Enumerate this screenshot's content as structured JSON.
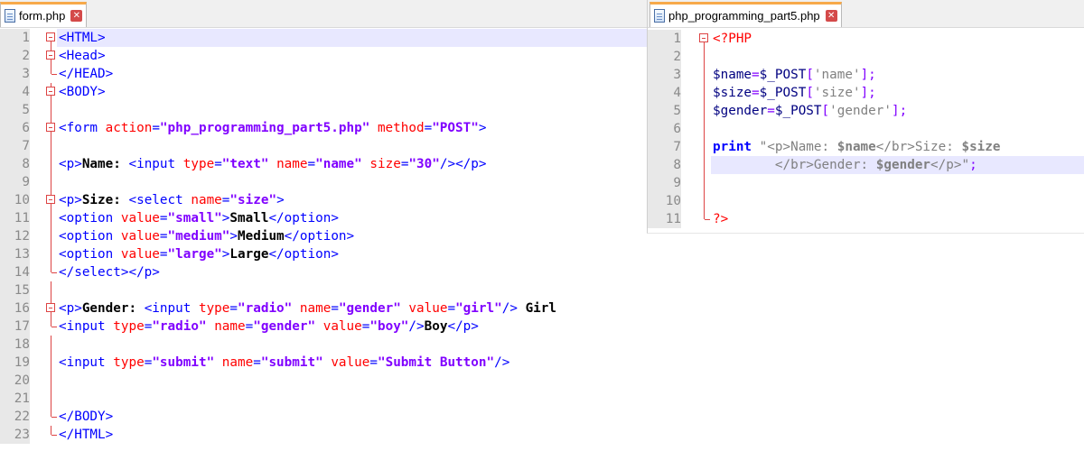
{
  "colors": {
    "accent_tab": "#f7a94a",
    "line_highlight": "#e8e8ff",
    "gutter": "#e8e8e8",
    "fold_marker": "#dd4444"
  },
  "left_pane": {
    "tab": {
      "label": "form.php",
      "icon": "document-icon",
      "close_icon": "close-icon"
    },
    "lines": [
      {
        "n": "1",
        "fold": "box",
        "hl": true,
        "tokens": [
          [
            "tag",
            "<HTML>"
          ]
        ]
      },
      {
        "n": "2",
        "fold": "box",
        "tokens": [
          [
            "tag",
            "<Head>"
          ]
        ]
      },
      {
        "n": "3",
        "fold": "end",
        "tokens": [
          [
            "tag",
            "</HEAD>"
          ]
        ]
      },
      {
        "n": "4",
        "fold": "box",
        "tokens": [
          [
            "tag",
            "<BODY>"
          ]
        ]
      },
      {
        "n": "5",
        "fold": "line",
        "tokens": []
      },
      {
        "n": "6",
        "fold": "box",
        "tokens": [
          [
            "tag",
            "<form "
          ],
          [
            "attr",
            "action"
          ],
          [
            "tag",
            "="
          ],
          [
            "str",
            "\"php_programming_part5.php\""
          ],
          [
            "tag",
            " "
          ],
          [
            "attr",
            "method"
          ],
          [
            "tag",
            "="
          ],
          [
            "str",
            "\"POST\""
          ],
          [
            "tag",
            ">"
          ]
        ]
      },
      {
        "n": "7",
        "fold": "line",
        "tokens": []
      },
      {
        "n": "8",
        "fold": "line",
        "tokens": [
          [
            "tag",
            "<p>"
          ],
          [
            "txt",
            "Name: "
          ],
          [
            "tag",
            "<input "
          ],
          [
            "attr",
            "type"
          ],
          [
            "tag",
            "="
          ],
          [
            "str",
            "\"text\""
          ],
          [
            "tag",
            " "
          ],
          [
            "attr",
            "name"
          ],
          [
            "tag",
            "="
          ],
          [
            "str",
            "\"name\""
          ],
          [
            "tag",
            " "
          ],
          [
            "attr",
            "size"
          ],
          [
            "tag",
            "="
          ],
          [
            "str",
            "\"30\""
          ],
          [
            "tag",
            "/></p>"
          ]
        ]
      },
      {
        "n": "9",
        "fold": "line",
        "tokens": []
      },
      {
        "n": "10",
        "fold": "box",
        "tokens": [
          [
            "tag",
            "<p>"
          ],
          [
            "txt",
            "Size: "
          ],
          [
            "tag",
            "<select "
          ],
          [
            "attr",
            "name"
          ],
          [
            "tag",
            "="
          ],
          [
            "str",
            "\"size\""
          ],
          [
            "tag",
            ">"
          ]
        ]
      },
      {
        "n": "11",
        "fold": "line",
        "tokens": [
          [
            "tag",
            "<option "
          ],
          [
            "attr",
            "value"
          ],
          [
            "tag",
            "="
          ],
          [
            "str",
            "\"small\""
          ],
          [
            "tag",
            ">"
          ],
          [
            "txt",
            "Small"
          ],
          [
            "tag",
            "</option>"
          ]
        ]
      },
      {
        "n": "12",
        "fold": "line",
        "tokens": [
          [
            "tag",
            "<option "
          ],
          [
            "attr",
            "value"
          ],
          [
            "tag",
            "="
          ],
          [
            "str",
            "\"medium\""
          ],
          [
            "tag",
            ">"
          ],
          [
            "txt",
            "Medium"
          ],
          [
            "tag",
            "</option>"
          ]
        ]
      },
      {
        "n": "13",
        "fold": "line",
        "tokens": [
          [
            "tag",
            "<option "
          ],
          [
            "attr",
            "value"
          ],
          [
            "tag",
            "="
          ],
          [
            "str",
            "\"large\""
          ],
          [
            "tag",
            ">"
          ],
          [
            "txt",
            "Large"
          ],
          [
            "tag",
            "</option>"
          ]
        ]
      },
      {
        "n": "14",
        "fold": "end",
        "tokens": [
          [
            "tag",
            "</select></p>"
          ]
        ]
      },
      {
        "n": "15",
        "fold": "line",
        "tokens": []
      },
      {
        "n": "16",
        "fold": "box",
        "tokens": [
          [
            "tag",
            "<p>"
          ],
          [
            "txt",
            "Gender: "
          ],
          [
            "tag",
            "<input "
          ],
          [
            "attr",
            "type"
          ],
          [
            "tag",
            "="
          ],
          [
            "str",
            "\"radio\""
          ],
          [
            "tag",
            " "
          ],
          [
            "attr",
            "name"
          ],
          [
            "tag",
            "="
          ],
          [
            "str",
            "\"gender\""
          ],
          [
            "tag",
            " "
          ],
          [
            "attr",
            "value"
          ],
          [
            "tag",
            "="
          ],
          [
            "str",
            "\"girl\""
          ],
          [
            "tag",
            "/> "
          ],
          [
            "txt",
            "Girl"
          ]
        ]
      },
      {
        "n": "17",
        "fold": "end",
        "tokens": [
          [
            "tag",
            "<input "
          ],
          [
            "attr",
            "type"
          ],
          [
            "tag",
            "="
          ],
          [
            "str",
            "\"radio\""
          ],
          [
            "tag",
            " "
          ],
          [
            "attr",
            "name"
          ],
          [
            "tag",
            "="
          ],
          [
            "str",
            "\"gender\""
          ],
          [
            "tag",
            " "
          ],
          [
            "attr",
            "value"
          ],
          [
            "tag",
            "="
          ],
          [
            "str",
            "\"boy\""
          ],
          [
            "tag",
            "/>"
          ],
          [
            "txt",
            "Boy"
          ],
          [
            "tag",
            "</p>"
          ]
        ]
      },
      {
        "n": "18",
        "fold": "line",
        "tokens": []
      },
      {
        "n": "19",
        "fold": "line",
        "tokens": [
          [
            "tag",
            "<input "
          ],
          [
            "attr",
            "type"
          ],
          [
            "tag",
            "="
          ],
          [
            "str",
            "\"submit\""
          ],
          [
            "tag",
            " "
          ],
          [
            "attr",
            "name"
          ],
          [
            "tag",
            "="
          ],
          [
            "str",
            "\"submit\""
          ],
          [
            "tag",
            " "
          ],
          [
            "attr",
            "value"
          ],
          [
            "tag",
            "="
          ],
          [
            "str",
            "\"Submit Button\""
          ],
          [
            "tag",
            "/>"
          ]
        ]
      },
      {
        "n": "20",
        "fold": "line",
        "tokens": []
      },
      {
        "n": "21",
        "fold": "line",
        "tokens": []
      },
      {
        "n": "22",
        "fold": "end",
        "tokens": [
          [
            "tag",
            "</BODY>"
          ]
        ]
      },
      {
        "n": "23",
        "fold": "end",
        "tokens": [
          [
            "tag",
            "</HTML>"
          ]
        ]
      }
    ]
  },
  "right_pane": {
    "tab": {
      "label": "php_programming_part5.php",
      "icon": "document-icon",
      "close_icon": "close-icon"
    },
    "lines": [
      {
        "n": "1",
        "fold": "box",
        "tokens": [
          [
            "php",
            "<?PHP"
          ]
        ]
      },
      {
        "n": "2",
        "fold": "line",
        "tokens": []
      },
      {
        "n": "3",
        "fold": "line",
        "tokens": [
          [
            "var",
            "$name"
          ],
          [
            "op",
            "="
          ],
          [
            "var",
            "$_POST"
          ],
          [
            "op",
            "["
          ],
          [
            "sq",
            "'name'"
          ],
          [
            "op",
            "];"
          ]
        ]
      },
      {
        "n": "4",
        "fold": "line",
        "tokens": [
          [
            "var",
            "$size"
          ],
          [
            "op",
            "="
          ],
          [
            "var",
            "$_POST"
          ],
          [
            "op",
            "["
          ],
          [
            "sq",
            "'size'"
          ],
          [
            "op",
            "];"
          ]
        ]
      },
      {
        "n": "5",
        "fold": "line",
        "tokens": [
          [
            "var",
            "$gender"
          ],
          [
            "op",
            "="
          ],
          [
            "var",
            "$_POST"
          ],
          [
            "op",
            "["
          ],
          [
            "sq",
            "'gender'"
          ],
          [
            "op",
            "];"
          ]
        ]
      },
      {
        "n": "6",
        "fold": "line",
        "tokens": []
      },
      {
        "n": "7",
        "fold": "line",
        "tokens": [
          [
            "kw",
            "print"
          ],
          [
            "plain",
            " "
          ],
          [
            "dq",
            "\"<p>Name: "
          ],
          [
            "dqv",
            "$name"
          ],
          [
            "dq",
            "</br>Size: "
          ],
          [
            "dqv",
            "$size"
          ]
        ]
      },
      {
        "n": "8",
        "fold": "line",
        "hl": true,
        "tokens": [
          [
            "plain",
            "        "
          ],
          [
            "dq",
            "</br>Gender: "
          ],
          [
            "dqv",
            "$gender"
          ],
          [
            "dq",
            "</p>\""
          ],
          [
            "op",
            ";"
          ]
        ]
      },
      {
        "n": "9",
        "fold": "line",
        "tokens": []
      },
      {
        "n": "10",
        "fold": "line",
        "tokens": []
      },
      {
        "n": "11",
        "fold": "end",
        "tokens": [
          [
            "php",
            "?>"
          ]
        ]
      }
    ]
  }
}
